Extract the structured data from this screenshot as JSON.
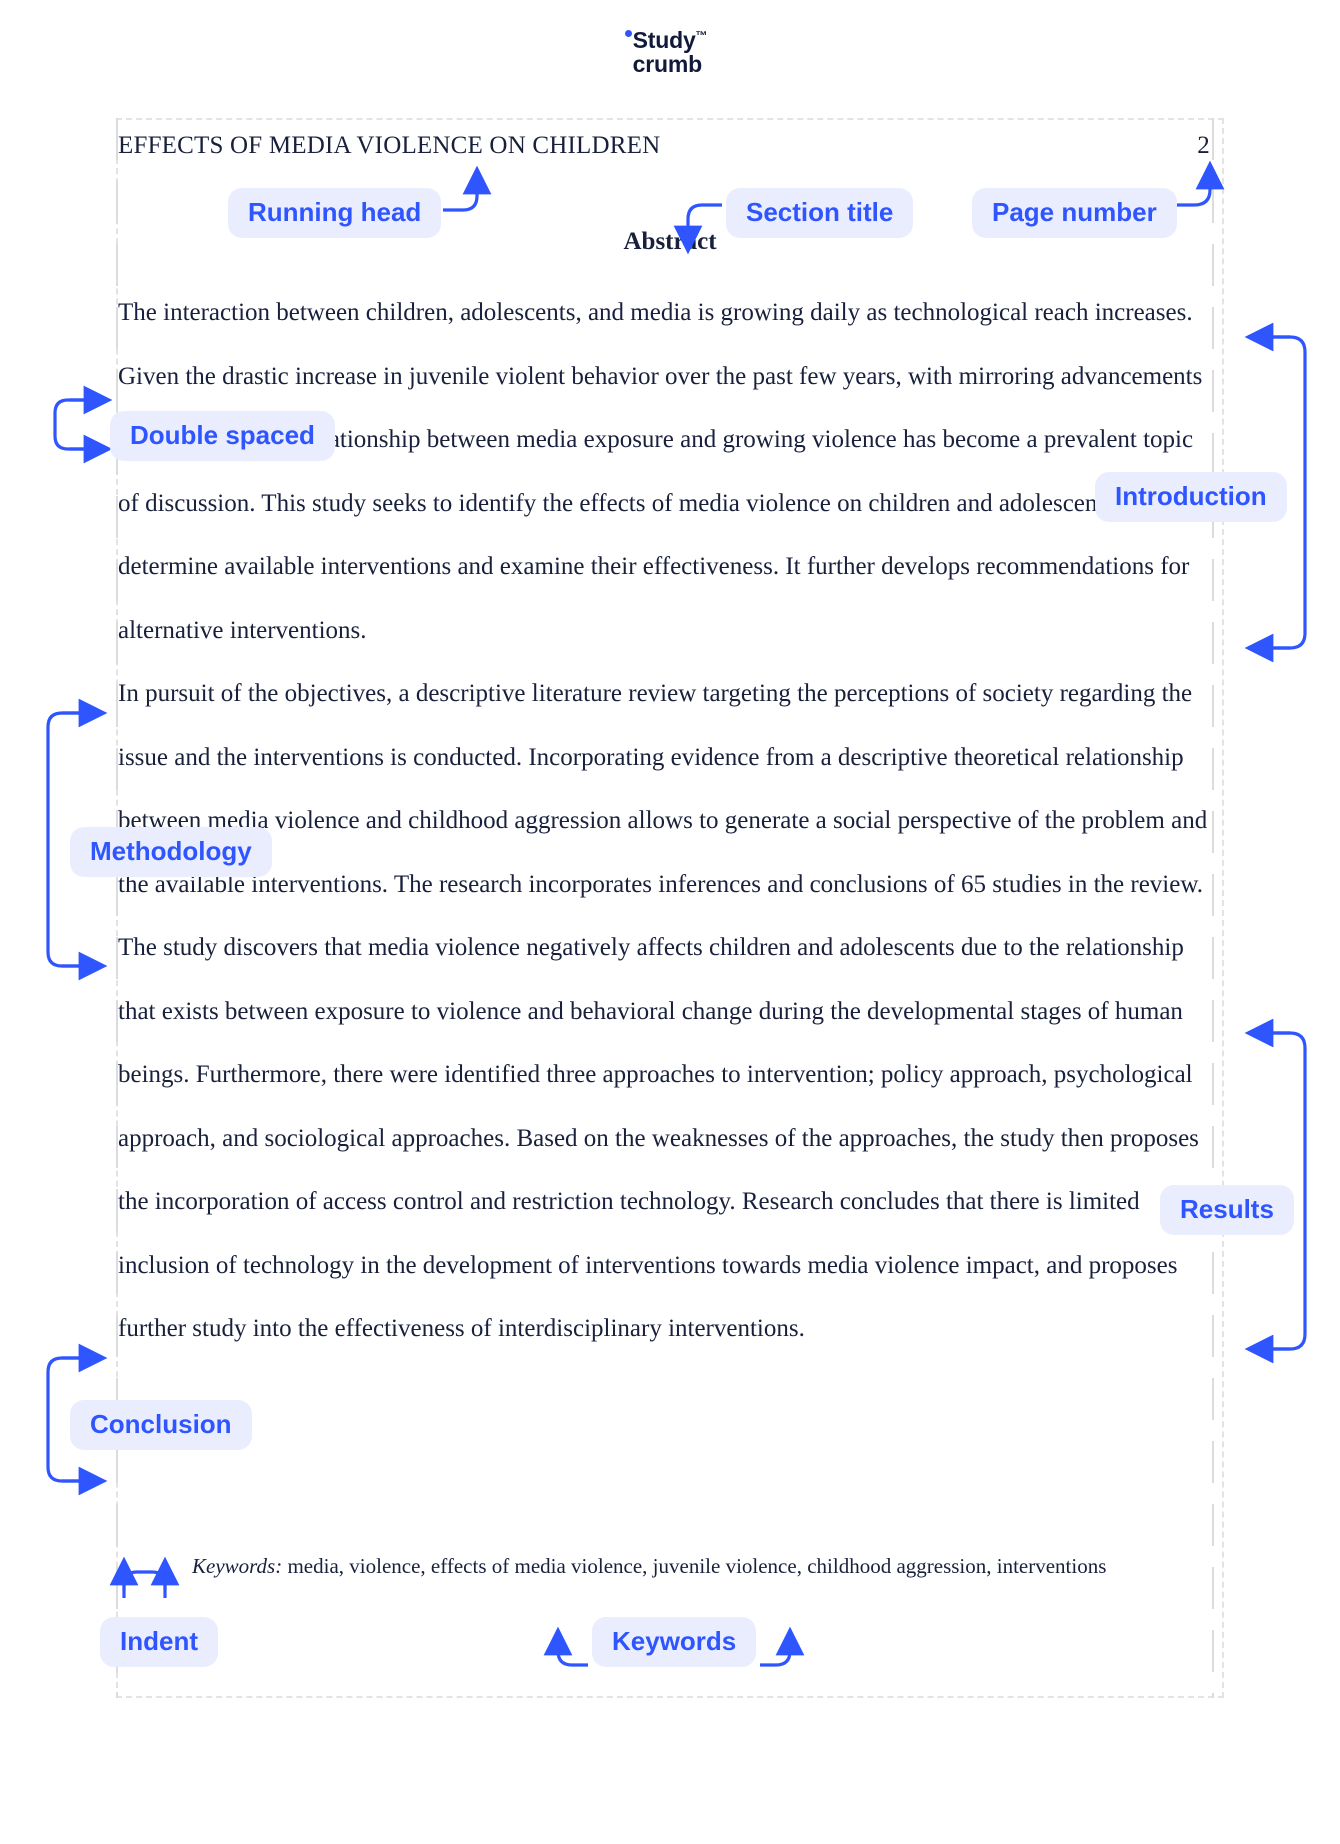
{
  "brand": {
    "name_line1": "Study",
    "trademark": "™",
    "name_line2": "crumb",
    "dot_color": "#2f55ff",
    "text_color": "#121a3a"
  },
  "document": {
    "running_head": "EFFECTS OF MEDIA VIOLENCE ON CHILDREN",
    "page_number": "2",
    "section_heading": "Abstract",
    "paragraphs": [
      "The interaction between children, adolescents, and media is growing daily as technological reach increases. Given the drastic increase in juvenile violent behavior over the past few years, with mirroring advancements in technology, the relationship between media exposure and growing violence has become a prevalent topic of discussion. This study seeks to identify the effects of media violence on children and adolescents, determine available interventions and examine their effectiveness. It further develops recommendations for alternative interventions.",
      "In pursuit of the objectives, a descriptive literature review targeting the perceptions of society regarding the issue and the interventions is conducted. Incorporating evidence from a descriptive theoretical relationship between media violence and childhood aggression allows to generate a social perspective of the problem and the available interventions. The research incorporates inferences and conclusions of 65 studies in the review.",
      "The study discovers that media violence negatively affects children and adolescents due to the relationship that exists between exposure to violence and behavioral change during the developmental stages of human beings. Furthermore, there were identified three approaches to intervention; policy approach, psychological approach, and sociological approaches. Based on the weaknesses of the approaches, the study then proposes the incorporation of access control and restriction technology. Research concludes that there is limited inclusion of technology in the development of interventions towards media violence impact, and proposes further study into the effectiveness of interdisciplinary interventions."
    ],
    "keywords_label": "Keywords:",
    "keywords_list": " media, violence, effects of media violence, juvenile violence, childhood aggression, interventions"
  },
  "annotations": {
    "accent_color": "#2f55ff",
    "pill_background": "#e9edfd",
    "labels": [
      {
        "id": "running-head",
        "text": "Running head"
      },
      {
        "id": "section-title",
        "text": "Section title"
      },
      {
        "id": "page-number",
        "text": "Page number"
      },
      {
        "id": "double-spaced",
        "text": "Double spaced"
      },
      {
        "id": "introduction",
        "text": "Introduction"
      },
      {
        "id": "methodology",
        "text": "Methodology"
      },
      {
        "id": "results",
        "text": "Results"
      },
      {
        "id": "conclusion",
        "text": "Conclusion"
      },
      {
        "id": "indent",
        "text": "Indent"
      },
      {
        "id": "keywords",
        "text": "Keywords"
      }
    ]
  }
}
